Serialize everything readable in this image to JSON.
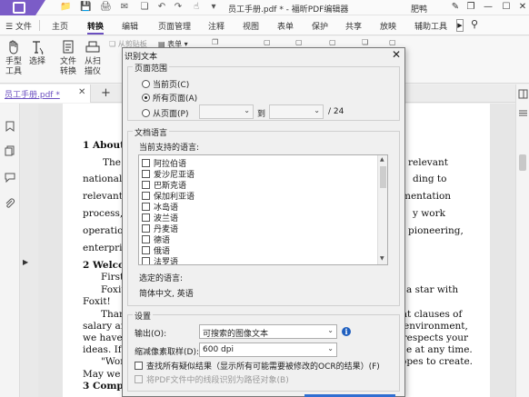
{
  "titlebar": {
    "app_title": "员工手册.pdf * - 福昕PDF编辑器",
    "user_name": "肥鸭",
    "quick_access": [
      "folder-icon",
      "save-icon",
      "print-icon",
      "email-icon",
      "undo-icon",
      "redo-icon",
      "dropdown-icon"
    ]
  },
  "menu": {
    "file": "文件",
    "tabs": [
      "主页",
      "转换",
      "编辑",
      "页面管理",
      "注释",
      "视图",
      "表单",
      "保护",
      "共享",
      "放映",
      "辅助工具"
    ],
    "active": "转换"
  },
  "toolbar": {
    "hand": "手型\n工具",
    "hand_l1": "手型",
    "hand_l2": "工具",
    "select": "选择",
    "file_convert_l1": "文件",
    "file_convert_l2": "转换",
    "from_scanner_l1": "从扫",
    "from_scanner_l2": "描仪",
    "from_clipboard": "从剪贴板",
    "form": "表单"
  },
  "doc_tab": {
    "label": "员工手册.pdf *"
  },
  "document": {
    "lines": [
      {
        "text": "1   About",
        "bold": true
      },
      {
        "text": "The",
        "bold": false
      },
      {
        "text": "national",
        "bold": false
      },
      {
        "text": "relevant",
        "bold": false
      },
      {
        "text": "process, a",
        "bold": false
      },
      {
        "text": "operation",
        "bold": false
      },
      {
        "text": "enterprise",
        "bold": false
      },
      {
        "text": "2   Welco",
        "bold": true
      },
      {
        "text": "First",
        "bold": false
      },
      {
        "text": "Foxit",
        "bold": false
      },
      {
        "text": "Foxit!",
        "bold": false
      },
      {
        "text": "Than",
        "bold": false
      },
      {
        "text": "salary and",
        "bold": false
      },
      {
        "text": "we have a",
        "bold": false
      },
      {
        "text": "ideas. If y",
        "bold": false
      },
      {
        "text": "\"Wor",
        "bold": false
      },
      {
        "text": "May we w",
        "bold": false
      },
      {
        "text": "3   Comp",
        "bold": true
      }
    ],
    "right_lines": [
      "relevant",
      "ding to",
      "mentation",
      "y work",
      "pioneering,",
      "a star with",
      "ant clauses of",
      "environment,",
      "o respects your",
      "e at any time.",
      "opes to create."
    ]
  },
  "dialog": {
    "title": "识别文本",
    "page_range": {
      "group_label": "页面范围",
      "current_page": "当前页(C)",
      "all_pages": "所有页面(A)",
      "from_page": "从页面(P)",
      "to_label": "到",
      "total": "/ 24",
      "selected": "all_pages"
    },
    "language": {
      "group_label": "文档语言",
      "supported_label": "当前支持的语言:",
      "items": [
        "阿拉伯语",
        "爱沙尼亚语",
        "巴斯克语",
        "保加利亚语",
        "冰岛语",
        "波兰语",
        "丹麦语",
        "德语",
        "俄语",
        "法罗语"
      ],
      "selected_label": "选定的语言:",
      "selected_value": "简体中文, 英语"
    },
    "settings": {
      "group_label": "设置",
      "output_label": "输出(O):",
      "output_value": "可搜索的图像文本",
      "downsample_label": "缩减像素取样(D):",
      "downsample_value": "600 dpi",
      "find_suspects": "查找所有疑似结果（显示所有可能需要被修改的OCR的结果）(F)",
      "vector_text": "将PDF文件中的线段识别为路径对象(B)"
    }
  },
  "colors": {
    "brand": "#7b5cc7",
    "accent": "#6b4fc0",
    "info": "#1f5fbf",
    "primary_button": "#2f6ed1"
  }
}
